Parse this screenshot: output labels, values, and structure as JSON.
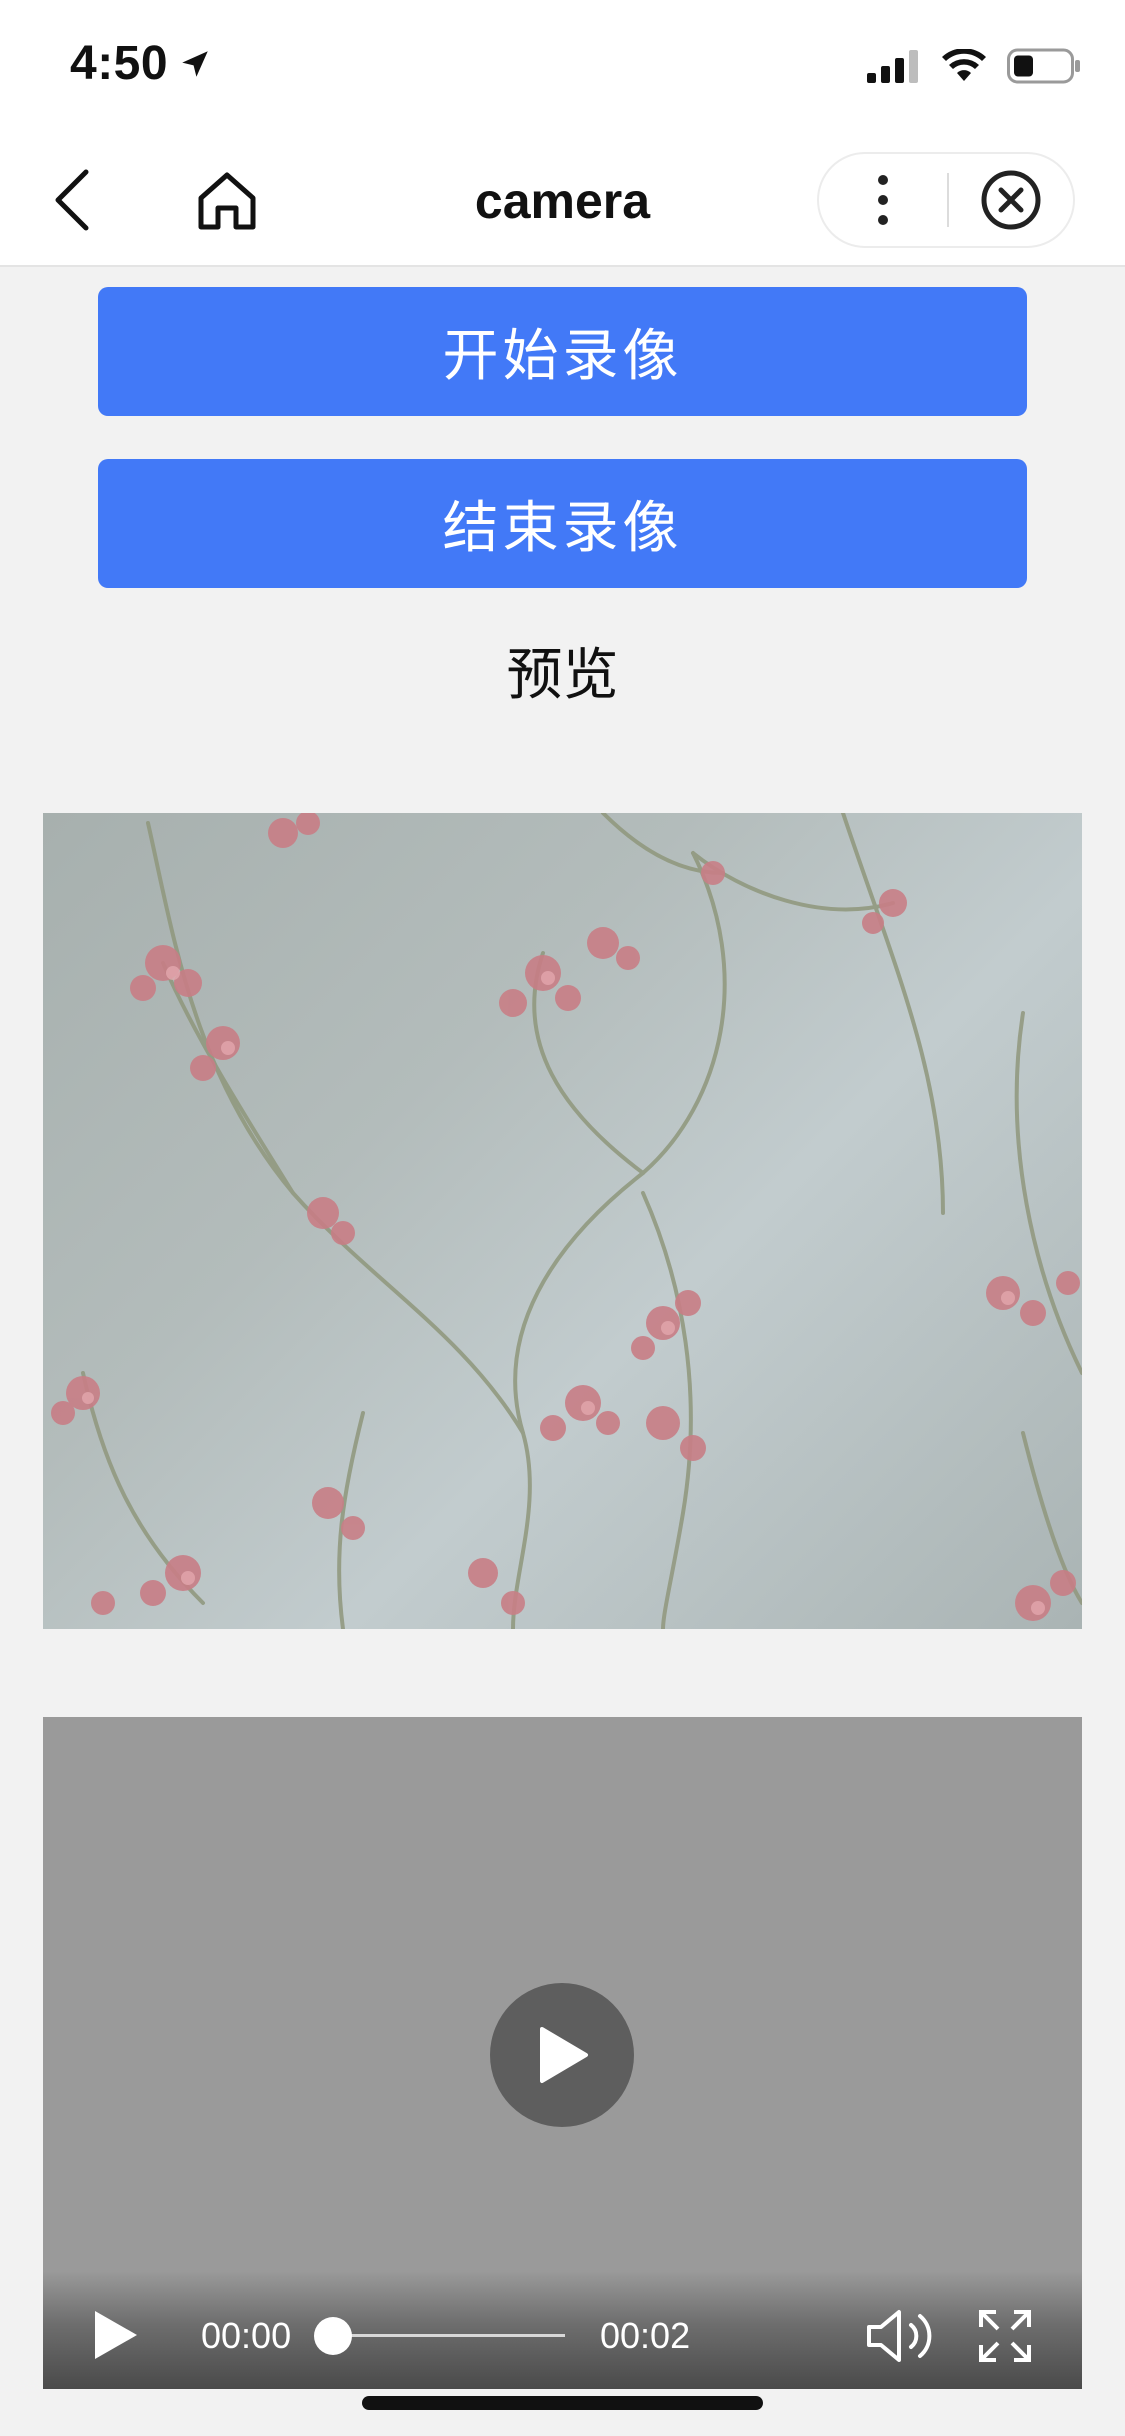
{
  "status_bar": {
    "time": "4:50",
    "location_icon": "location-arrow-icon",
    "signal_icon": "cellular-signal-icon",
    "wifi_icon": "wifi-icon",
    "battery_icon": "battery-icon"
  },
  "nav": {
    "title": "camera",
    "back_icon": "chevron-left-icon",
    "home_icon": "home-icon",
    "more_icon": "more-vertical-icon",
    "close_icon": "close-circle-icon"
  },
  "actions": {
    "start_label": "开始录像",
    "stop_label": "结束录像"
  },
  "preview": {
    "label": "预览"
  },
  "video": {
    "current_time": "00:00",
    "total_time": "00:02",
    "progress": 0,
    "play_icon": "play-icon",
    "volume_icon": "volume-icon",
    "fullscreen_icon": "fullscreen-icon"
  },
  "colors": {
    "accent": "#4279f7",
    "page_background": "#f2f2f2",
    "video_background": "#9a9a9a"
  }
}
